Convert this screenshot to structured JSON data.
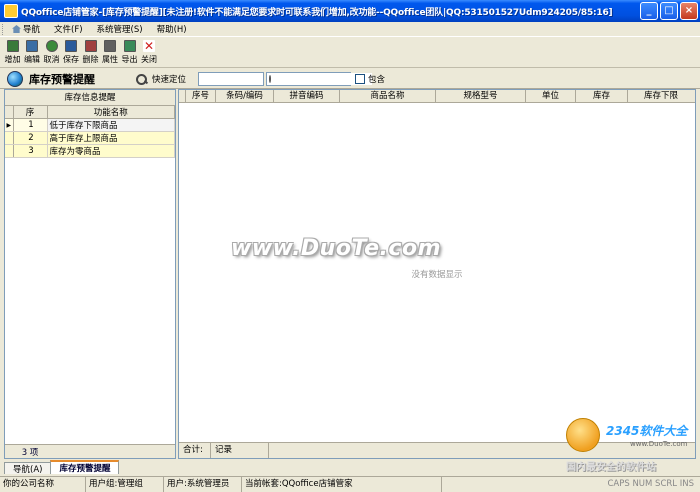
{
  "window": {
    "title": "QQoffice店铺管家-[库存预警提醒][未注册!软件不能满足您要求时可联系我们增加,改功能--QQoffice团队|QQ:531501527Udm924205/85:16]",
    "controls": [
      "_",
      "□",
      "×"
    ]
  },
  "menu": {
    "items": [
      {
        "label": "导航"
      },
      {
        "label": "文件(F)"
      },
      {
        "label": "系统管理(S)"
      },
      {
        "label": "帮助(H)"
      }
    ]
  },
  "toolbar": {
    "buttons": [
      {
        "label": "增加",
        "icon": "add-icon",
        "color": "#3a7a3a"
      },
      {
        "label": "编辑",
        "icon": "edit-icon",
        "color": "#3a6ea5"
      },
      {
        "label": "取消",
        "icon": "undo-icon",
        "color": "#3a8a3a"
      },
      {
        "label": "保存",
        "icon": "save-icon",
        "color": "#2a5a9a"
      },
      {
        "label": "删除",
        "icon": "delete-icon",
        "color": "#a04040"
      },
      {
        "label": "属性",
        "icon": "properties-icon",
        "color": "#606060"
      },
      {
        "label": "导出",
        "icon": "export-icon",
        "color": "#3a8a5a"
      },
      {
        "label": "关闭",
        "icon": "close-icon",
        "color": "#d02020"
      }
    ]
  },
  "subheader": {
    "title": "库存预警提醒",
    "locate_label": "快速定位",
    "search_placeholder": "",
    "include_label": "包含"
  },
  "left_panel": {
    "header": "库存信息提醒",
    "columns": [
      "序",
      "功能名称"
    ],
    "rows": [
      {
        "no": "1",
        "name": "低于库存下限商品"
      },
      {
        "no": "2",
        "name": "高于库存上限商品"
      },
      {
        "no": "3",
        "name": "库存为零商品"
      }
    ],
    "count_label": "3 项"
  },
  "grid": {
    "columns": [
      "序号",
      "条码/编码",
      "拼音编码",
      "商品名称",
      "规格型号",
      "单位",
      "库存",
      "库存下限"
    ],
    "empty_message": "没有数据显示",
    "footer_sum": "合计:",
    "footer_records": "记录"
  },
  "watermark": {
    "text": "www.DuoTe.com"
  },
  "corner_badge": {
    "brand": "2345软件大全",
    "site": "www.DuoTe.com",
    "slogan": "国内最安全的软件站"
  },
  "tabs": [
    {
      "label": "导航(A)",
      "active": false
    },
    {
      "label": "库存预警提醒",
      "active": true
    }
  ],
  "status": {
    "company": "你的公司名称",
    "user_group": "用户组:管理组",
    "user": "用户:系统管理员",
    "account": "当前帐套:QQoffice店铺管家",
    "indicators": "CAPS NUM SCRL INS"
  }
}
